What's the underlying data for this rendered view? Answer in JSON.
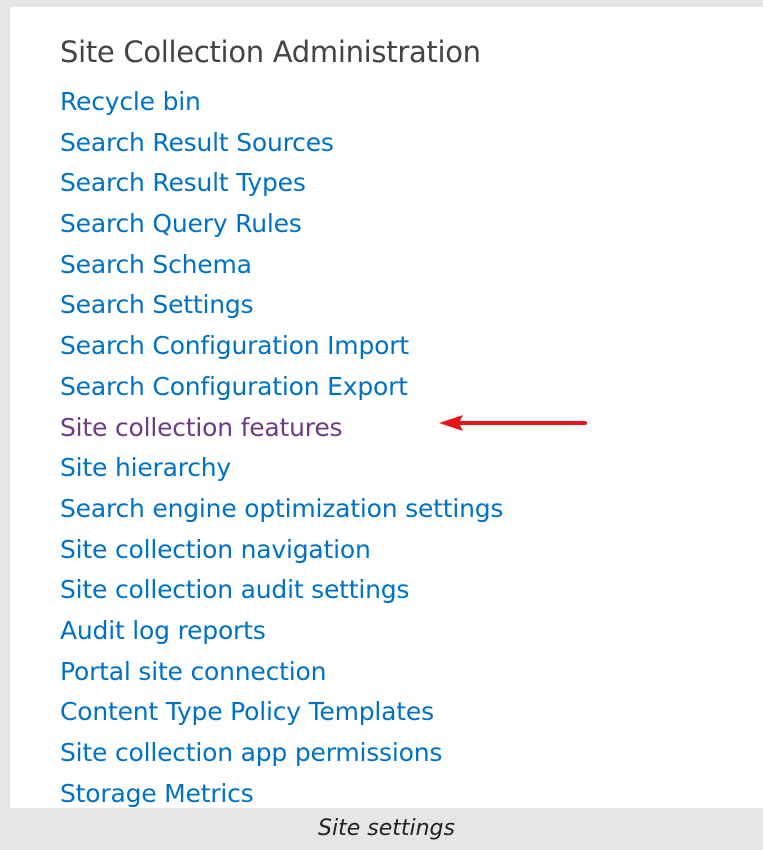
{
  "section": {
    "heading": "Site Collection Administration"
  },
  "links": [
    {
      "label": "Recycle bin",
      "visited": false
    },
    {
      "label": "Search Result Sources",
      "visited": false
    },
    {
      "label": "Search Result Types",
      "visited": false
    },
    {
      "label": "Search Query Rules",
      "visited": false
    },
    {
      "label": "Search Schema",
      "visited": false
    },
    {
      "label": "Search Settings",
      "visited": false
    },
    {
      "label": "Search Configuration Import",
      "visited": false
    },
    {
      "label": "Search Configuration Export",
      "visited": false
    },
    {
      "label": "Site collection features",
      "visited": true
    },
    {
      "label": "Site hierarchy",
      "visited": false
    },
    {
      "label": "Search engine optimization settings",
      "visited": false
    },
    {
      "label": "Site collection navigation",
      "visited": false
    },
    {
      "label": "Site collection audit settings",
      "visited": false
    },
    {
      "label": "Audit log reports",
      "visited": false
    },
    {
      "label": "Portal site connection",
      "visited": false
    },
    {
      "label": "Content Type Policy Templates",
      "visited": false
    },
    {
      "label": "Site collection app permissions",
      "visited": false
    },
    {
      "label": "Storage Metrics",
      "visited": false
    }
  ],
  "annotation": {
    "arrow_icon": "red-left-arrow-icon",
    "arrow_color": "#e8141b"
  },
  "caption": "Site settings",
  "colors": {
    "link": "#0072c6",
    "visited_link": "#6d3c84",
    "heading": "#444444",
    "border": "#e6e6e6"
  }
}
